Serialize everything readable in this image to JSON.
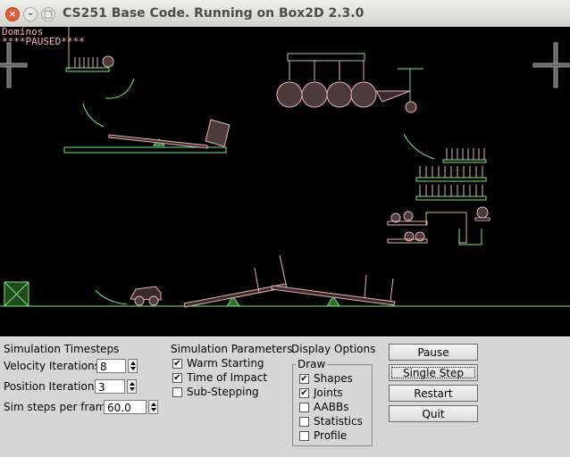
{
  "window": {
    "title": "CS251 Base Code. Running on Box2D 2.3.0",
    "close_glyph": "×",
    "minimize_glyph": "–",
    "maximize_glyph": "□"
  },
  "sim": {
    "test_name": "Dominos",
    "status": "****PAUSED****",
    "colors": {
      "shape": "#e6b3b3",
      "static": "#80e680",
      "joint": "#80cccc"
    }
  },
  "timesteps": {
    "heading": "Simulation Timesteps",
    "velocity_label": "Velocity Iterations",
    "velocity_value": "8",
    "position_label": "Position Iterations",
    "position_value": "3",
    "hz_label": "Sim steps per frame",
    "hz_value": "60.0"
  },
  "params": {
    "heading": "Simulation Parameters",
    "warm_starting": {
      "label": "Warm Starting",
      "checked": true
    },
    "time_of_impact": {
      "label": "Time of Impact",
      "checked": true
    },
    "sub_stepping": {
      "label": "Sub-Stepping",
      "checked": false
    }
  },
  "display": {
    "heading": "Display Options",
    "group_label": "Draw",
    "shapes": {
      "label": "Shapes",
      "checked": true
    },
    "joints": {
      "label": "Joints",
      "checked": true
    },
    "aabbs": {
      "label": "AABBs",
      "checked": false
    },
    "statistics": {
      "label": "Statistics",
      "checked": false
    },
    "profile": {
      "label": "Profile",
      "checked": false
    }
  },
  "buttons": {
    "pause": "Pause",
    "single_step": "Single Step",
    "restart": "Restart",
    "quit": "Quit"
  }
}
